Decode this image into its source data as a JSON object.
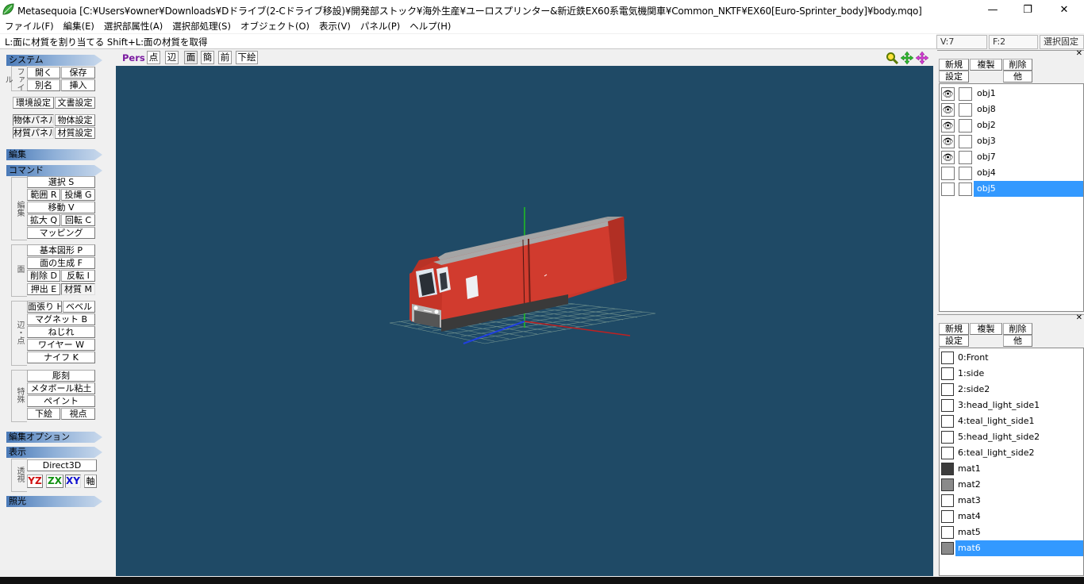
{
  "window": {
    "title": "Metasequoia [C:¥Users¥owner¥Downloads¥Dドライブ(2-Cドライブ移設)¥開発部ストック¥海外生産¥ユーロスプリンター&新近鉄EX60系電気機関車¥Common_NKTF¥EX60[Euro-Sprinter_body]¥body.mqo]",
    "minimize": "—",
    "maximize": "❐",
    "close": "✕"
  },
  "menu": [
    "ファイル(F)",
    "編集(E)",
    "選択部属性(A)",
    "選択部処理(S)",
    "オブジェクト(O)",
    "表示(V)",
    "パネル(P)",
    "ヘルプ(H)"
  ],
  "status": {
    "hint": "L:面に材質を割り当てる   Shift+L:面の材質を取得",
    "v": "V:7",
    "f": "F:2",
    "lock": "選択固定"
  },
  "left": {
    "system": "システム",
    "file_label": "ファイル",
    "open": "開く",
    "save": "保存",
    "saveas": "別名",
    "insert": "挿入",
    "env": "環境設定",
    "doc": "文書設定",
    "objpanel": "物体パネル",
    "objset": "物体設定",
    "matpanel": "材質パネル",
    "matset": "材質設定",
    "edit": "編集",
    "command": "コマンド",
    "edit_label": "編集",
    "select": "選択 S",
    "range": "範囲 R",
    "lasso": "投縄 G",
    "move": "移動 V",
    "scale": "拡大 Q",
    "rotate": "回転 C",
    "mapping": "マッピング",
    "face_label": "面",
    "basic": "基本図形 P",
    "facegen": "面の生成 F",
    "delete": "削除 D",
    "flip": "反転 I",
    "extrude": "押出 E",
    "material": "材質 M",
    "edge_label": "辺・点",
    "faceh": "面張り H",
    "bevel": "ベベル",
    "magnet": "マグネット B",
    "twist": "ねじれ",
    "wire": "ワイヤー W",
    "knife": "ナイフ K",
    "special_label": "特殊",
    "carve": "彫刻",
    "metaball": "メタボール粘土",
    "paint": "ペイント",
    "under": "下絵",
    "view": "視点",
    "editopt": "編集オプション",
    "display": "表示",
    "persp_label": "透視",
    "d3d": "Direct3D",
    "yz": "YZ",
    "zx": "ZX",
    "xy": "XY",
    "axis": "軸",
    "light": "照光"
  },
  "viewport": {
    "pers": "Pers",
    "point": "点",
    "edge": "辺",
    "face": "面",
    "simple": "簡",
    "front": "前",
    "under": "下絵"
  },
  "objects": {
    "new": "新規",
    "copy": "複製",
    "delete": "削除",
    "settings": "設定",
    "other": "他",
    "items": [
      {
        "name": "obj1",
        "visible": true
      },
      {
        "name": "obj8",
        "visible": true
      },
      {
        "name": "obj2",
        "visible": true
      },
      {
        "name": "obj3",
        "visible": true
      },
      {
        "name": "obj7",
        "visible": true
      },
      {
        "name": "obj4",
        "visible": false
      },
      {
        "name": "obj5",
        "visible": false
      }
    ]
  },
  "materials": {
    "new": "新規",
    "copy": "複製",
    "delete": "削除",
    "settings": "設定",
    "other": "他",
    "items": [
      {
        "name": "0:Front",
        "color": "#ffffff"
      },
      {
        "name": "1:side",
        "color": "#ffffff"
      },
      {
        "name": "2:side2",
        "color": "#ffffff"
      },
      {
        "name": "3:head_light_side1",
        "color": "#ffffff"
      },
      {
        "name": "4:teal_light_side1",
        "color": "#ffffff"
      },
      {
        "name": "5:head_light_side2",
        "color": "#ffffff"
      },
      {
        "name": "6:teal_light_side2",
        "color": "#ffffff"
      },
      {
        "name": "mat1",
        "color": "#3c3c3c"
      },
      {
        "name": "mat2",
        "color": "#8a8a8a"
      },
      {
        "name": "mat3",
        "color": "#ffffff"
      },
      {
        "name": "mat4",
        "color": "#ffffff"
      },
      {
        "name": "mat5",
        "color": "#ffffff"
      },
      {
        "name": "mat6",
        "color": "#8a8a8a"
      }
    ]
  },
  "colors": {
    "viewport_bg": "#1f4a66",
    "selection": "#3399ff",
    "train_red": "#d13b2e"
  }
}
